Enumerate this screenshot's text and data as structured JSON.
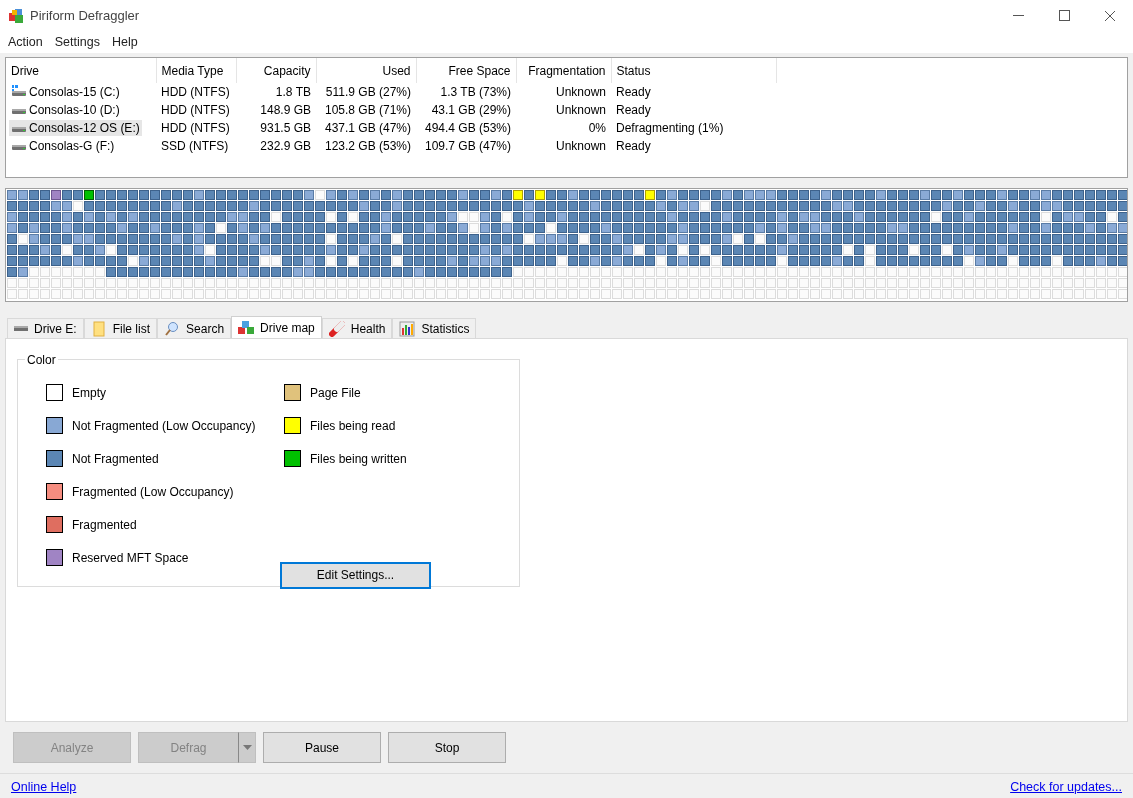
{
  "window": {
    "title": "Piriform Defraggler"
  },
  "menu": [
    "Action",
    "Settings",
    "Help"
  ],
  "drives": {
    "columns": [
      "Drive",
      "Media Type",
      "Capacity",
      "Used",
      "Free Space",
      "Fragmentation",
      "Status"
    ],
    "rows": [
      {
        "kind": "system",
        "selected": false,
        "cells": [
          "Consolas-15 (C:)",
          "HDD (NTFS)",
          "1.8 TB",
          "511.9 GB (27%)",
          "1.3 TB (73%)",
          "Unknown",
          "Ready"
        ]
      },
      {
        "kind": "disk",
        "selected": false,
        "cells": [
          "Consolas-10 (D:)",
          "HDD (NTFS)",
          "148.9 GB",
          "105.8 GB (71%)",
          "43.1 GB (29%)",
          "Unknown",
          "Ready"
        ]
      },
      {
        "kind": "disk",
        "selected": true,
        "cells": [
          "Consolas-12 OS (E:)",
          "HDD (NTFS)",
          "931.5 GB",
          "437.1 GB (47%)",
          "494.4 GB (53%)",
          "0%",
          "Defragmenting (1%)"
        ]
      },
      {
        "kind": "disk",
        "selected": false,
        "cells": [
          "Consolas-G (F:)",
          "SSD (NTFS)",
          "232.9 GB",
          "123.2 GB (53%)",
          "109.7 GB (47%)",
          "Unknown",
          "Ready"
        ]
      }
    ]
  },
  "tabs": [
    {
      "label": "Drive E:",
      "selected": false
    },
    {
      "label": "File list",
      "selected": false
    },
    {
      "label": "Search",
      "selected": false
    },
    {
      "label": "Drive map",
      "selected": true
    },
    {
      "label": "Health",
      "selected": false
    },
    {
      "label": "Statistics",
      "selected": false
    }
  ],
  "legend": {
    "title": "Color",
    "columns": [
      [
        {
          "label": "Empty",
          "color": "#ffffff"
        },
        {
          "label": "Not Fragmented (Low Occupancy)",
          "color": "#88a8d4"
        },
        {
          "label": "Not Fragmented",
          "color": "#5b86b4"
        },
        {
          "label": "Fragmented (Low Occupancy)",
          "color": "#f68d80"
        },
        {
          "label": "Fragmented",
          "color": "#df6e60"
        },
        {
          "label": "Reserved MFT Space",
          "color": "#a084c4"
        }
      ],
      [
        {
          "label": "Page File",
          "color": "#e0c27c"
        },
        {
          "label": "Files being read",
          "color": "#ffff00"
        },
        {
          "label": "Files being written",
          "color": "#00c000"
        }
      ]
    ],
    "button": "Edit Settings..."
  },
  "buttons": [
    {
      "label": "Analyze",
      "disabled": true
    },
    {
      "label": "Defrag",
      "disabled": true,
      "dropdown": true
    },
    {
      "label": "Pause",
      "disabled": false
    },
    {
      "label": "Stop",
      "disabled": false
    }
  ],
  "footer": {
    "left": "Online Help",
    "right": "Check for updates..."
  }
}
